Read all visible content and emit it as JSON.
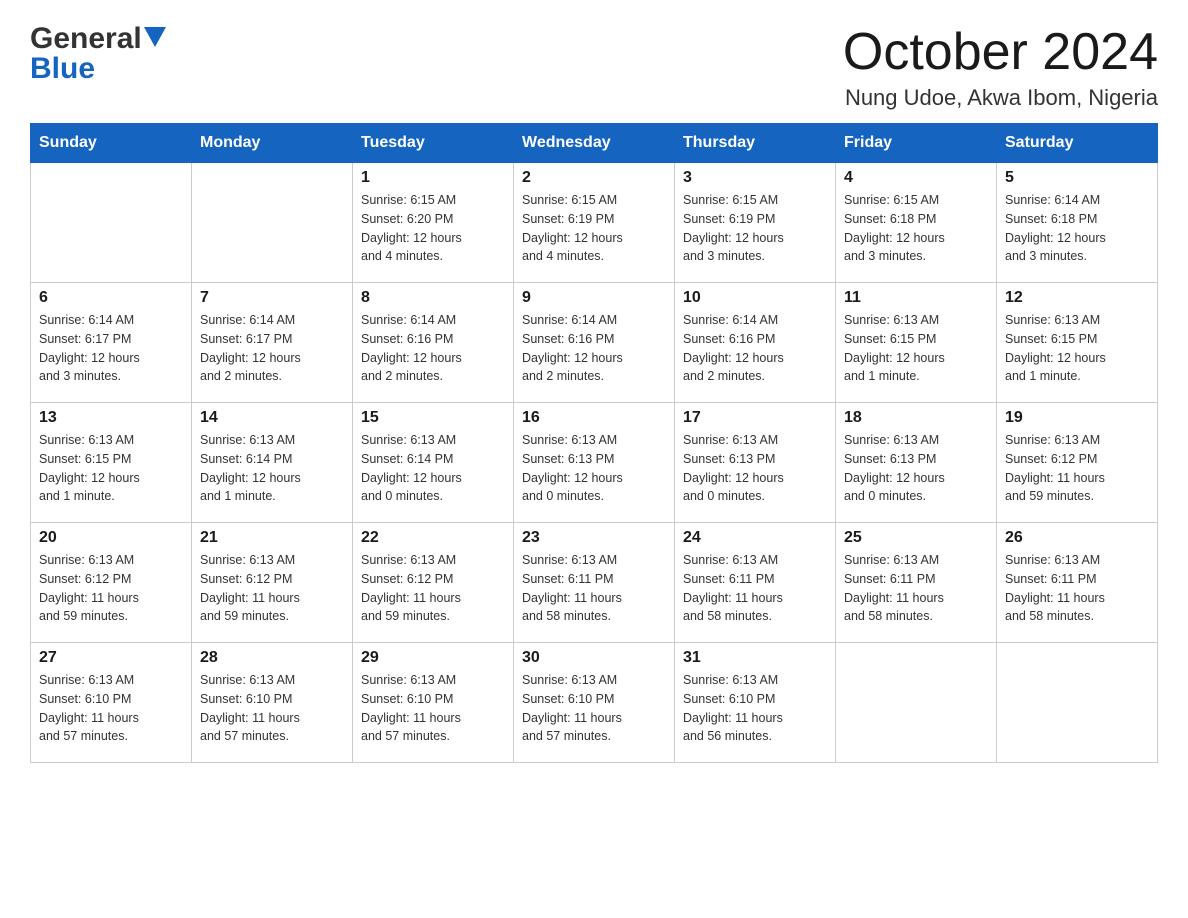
{
  "logo": {
    "general": "General",
    "blue": "Blue"
  },
  "title": "October 2024",
  "subtitle": "Nung Udoe, Akwa Ibom, Nigeria",
  "weekdays": [
    "Sunday",
    "Monday",
    "Tuesday",
    "Wednesday",
    "Thursday",
    "Friday",
    "Saturday"
  ],
  "weeks": [
    [
      {
        "day": "",
        "info": ""
      },
      {
        "day": "",
        "info": ""
      },
      {
        "day": "1",
        "info": "Sunrise: 6:15 AM\nSunset: 6:20 PM\nDaylight: 12 hours\nand 4 minutes."
      },
      {
        "day": "2",
        "info": "Sunrise: 6:15 AM\nSunset: 6:19 PM\nDaylight: 12 hours\nand 4 minutes."
      },
      {
        "day": "3",
        "info": "Sunrise: 6:15 AM\nSunset: 6:19 PM\nDaylight: 12 hours\nand 3 minutes."
      },
      {
        "day": "4",
        "info": "Sunrise: 6:15 AM\nSunset: 6:18 PM\nDaylight: 12 hours\nand 3 minutes."
      },
      {
        "day": "5",
        "info": "Sunrise: 6:14 AM\nSunset: 6:18 PM\nDaylight: 12 hours\nand 3 minutes."
      }
    ],
    [
      {
        "day": "6",
        "info": "Sunrise: 6:14 AM\nSunset: 6:17 PM\nDaylight: 12 hours\nand 3 minutes."
      },
      {
        "day": "7",
        "info": "Sunrise: 6:14 AM\nSunset: 6:17 PM\nDaylight: 12 hours\nand 2 minutes."
      },
      {
        "day": "8",
        "info": "Sunrise: 6:14 AM\nSunset: 6:16 PM\nDaylight: 12 hours\nand 2 minutes."
      },
      {
        "day": "9",
        "info": "Sunrise: 6:14 AM\nSunset: 6:16 PM\nDaylight: 12 hours\nand 2 minutes."
      },
      {
        "day": "10",
        "info": "Sunrise: 6:14 AM\nSunset: 6:16 PM\nDaylight: 12 hours\nand 2 minutes."
      },
      {
        "day": "11",
        "info": "Sunrise: 6:13 AM\nSunset: 6:15 PM\nDaylight: 12 hours\nand 1 minute."
      },
      {
        "day": "12",
        "info": "Sunrise: 6:13 AM\nSunset: 6:15 PM\nDaylight: 12 hours\nand 1 minute."
      }
    ],
    [
      {
        "day": "13",
        "info": "Sunrise: 6:13 AM\nSunset: 6:15 PM\nDaylight: 12 hours\nand 1 minute."
      },
      {
        "day": "14",
        "info": "Sunrise: 6:13 AM\nSunset: 6:14 PM\nDaylight: 12 hours\nand 1 minute."
      },
      {
        "day": "15",
        "info": "Sunrise: 6:13 AM\nSunset: 6:14 PM\nDaylight: 12 hours\nand 0 minutes."
      },
      {
        "day": "16",
        "info": "Sunrise: 6:13 AM\nSunset: 6:13 PM\nDaylight: 12 hours\nand 0 minutes."
      },
      {
        "day": "17",
        "info": "Sunrise: 6:13 AM\nSunset: 6:13 PM\nDaylight: 12 hours\nand 0 minutes."
      },
      {
        "day": "18",
        "info": "Sunrise: 6:13 AM\nSunset: 6:13 PM\nDaylight: 12 hours\nand 0 minutes."
      },
      {
        "day": "19",
        "info": "Sunrise: 6:13 AM\nSunset: 6:12 PM\nDaylight: 11 hours\nand 59 minutes."
      }
    ],
    [
      {
        "day": "20",
        "info": "Sunrise: 6:13 AM\nSunset: 6:12 PM\nDaylight: 11 hours\nand 59 minutes."
      },
      {
        "day": "21",
        "info": "Sunrise: 6:13 AM\nSunset: 6:12 PM\nDaylight: 11 hours\nand 59 minutes."
      },
      {
        "day": "22",
        "info": "Sunrise: 6:13 AM\nSunset: 6:12 PM\nDaylight: 11 hours\nand 59 minutes."
      },
      {
        "day": "23",
        "info": "Sunrise: 6:13 AM\nSunset: 6:11 PM\nDaylight: 11 hours\nand 58 minutes."
      },
      {
        "day": "24",
        "info": "Sunrise: 6:13 AM\nSunset: 6:11 PM\nDaylight: 11 hours\nand 58 minutes."
      },
      {
        "day": "25",
        "info": "Sunrise: 6:13 AM\nSunset: 6:11 PM\nDaylight: 11 hours\nand 58 minutes."
      },
      {
        "day": "26",
        "info": "Sunrise: 6:13 AM\nSunset: 6:11 PM\nDaylight: 11 hours\nand 58 minutes."
      }
    ],
    [
      {
        "day": "27",
        "info": "Sunrise: 6:13 AM\nSunset: 6:10 PM\nDaylight: 11 hours\nand 57 minutes."
      },
      {
        "day": "28",
        "info": "Sunrise: 6:13 AM\nSunset: 6:10 PM\nDaylight: 11 hours\nand 57 minutes."
      },
      {
        "day": "29",
        "info": "Sunrise: 6:13 AM\nSunset: 6:10 PM\nDaylight: 11 hours\nand 57 minutes."
      },
      {
        "day": "30",
        "info": "Sunrise: 6:13 AM\nSunset: 6:10 PM\nDaylight: 11 hours\nand 57 minutes."
      },
      {
        "day": "31",
        "info": "Sunrise: 6:13 AM\nSunset: 6:10 PM\nDaylight: 11 hours\nand 56 minutes."
      },
      {
        "day": "",
        "info": ""
      },
      {
        "day": "",
        "info": ""
      }
    ]
  ]
}
